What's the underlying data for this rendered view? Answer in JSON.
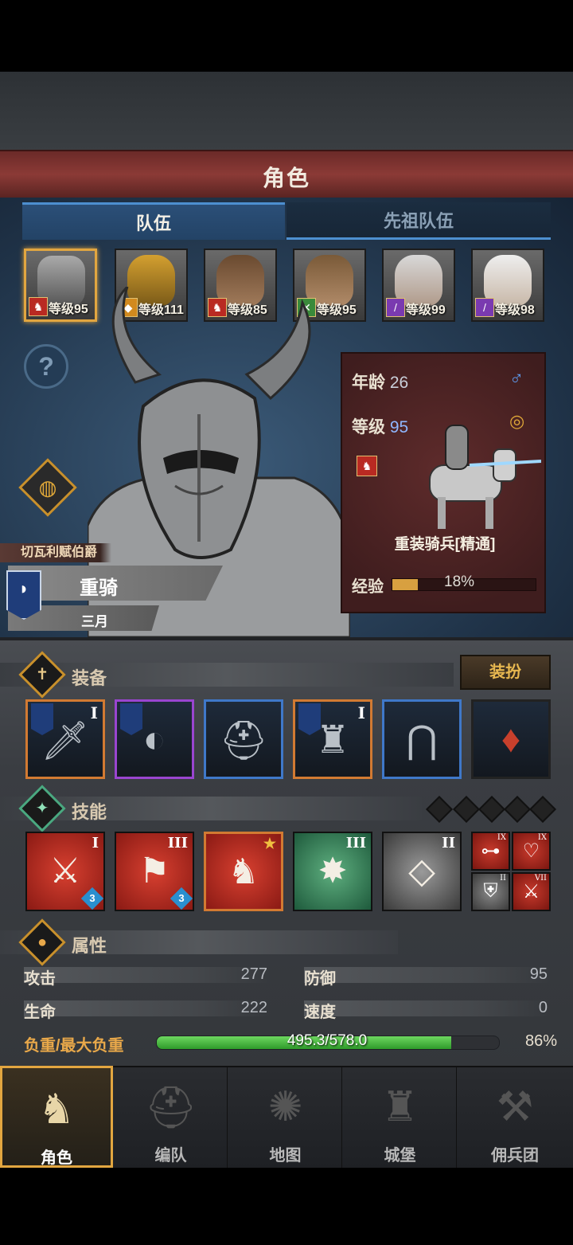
{
  "header": {
    "title": "角色"
  },
  "tabs": [
    {
      "label": "队伍",
      "active": true
    },
    {
      "label": "先祖队伍",
      "active": false
    }
  ],
  "team": [
    {
      "level": "等级95",
      "class_icon": "horse-icon",
      "class_color": "#b92a22",
      "selected": true
    },
    {
      "level": "等级111",
      "class_icon": "shield-icon",
      "class_color": "#d28a1e",
      "selected": false
    },
    {
      "level": "等级85",
      "class_icon": "horse-icon",
      "class_color": "#b92a22",
      "selected": false
    },
    {
      "level": "等级95",
      "class_icon": "bow-icon",
      "class_color": "#3a8a3a",
      "selected": false
    },
    {
      "level": "等级99",
      "class_icon": "staff-icon",
      "class_color": "#7a3ab0",
      "selected": false
    },
    {
      "level": "等级98",
      "class_icon": "staff-icon",
      "class_color": "#7a3ab0",
      "selected": false
    }
  ],
  "hero": {
    "title": "切瓦利赋伯爵",
    "name": "重骑",
    "month": "三月"
  },
  "info": {
    "age_label": "年龄",
    "age": "26",
    "level_label": "等级",
    "level": "95",
    "class_name": "重装骑兵[精通]",
    "exp_label": "经验",
    "exp_text": "18%",
    "exp_fraction": 0.18
  },
  "equipment": {
    "title": "装备",
    "dress_button": "装扮",
    "items": [
      {
        "icon": "sword-icon",
        "rank": "I",
        "rarity": "orange",
        "banner": true
      },
      {
        "icon": "shield-icon",
        "rank": "",
        "rarity": "purple",
        "banner": true
      },
      {
        "icon": "helmet-icon",
        "rank": "",
        "rarity": "blue",
        "banner": false
      },
      {
        "icon": "armor-icon",
        "rank": "I",
        "rarity": "orange",
        "banner": true
      },
      {
        "icon": "greaves-icon",
        "rank": "",
        "rarity": "blue",
        "banner": false
      },
      {
        "icon": "amulet-icon",
        "rank": "",
        "rarity": "none",
        "banner": false
      }
    ]
  },
  "skills": {
    "title": "技能",
    "items": [
      {
        "icon": "sword-skill-icon",
        "rank": "I",
        "color": "red",
        "level": "3",
        "selected": false
      },
      {
        "icon": "banner-skill-icon",
        "rank": "III",
        "color": "red",
        "level": "3",
        "selected": false
      },
      {
        "icon": "charge-skill-icon",
        "rank": "",
        "color": "red",
        "level": "",
        "selected": true
      },
      {
        "icon": "crystal-burst-icon",
        "rank": "III",
        "color": "green",
        "level": "",
        "selected": false
      },
      {
        "icon": "crystal-hand-icon",
        "rank": "II",
        "color": "grey",
        "level": "",
        "selected": false
      }
    ],
    "passives": [
      {
        "icon": "dumbbell-icon",
        "rank": "IX"
      },
      {
        "icon": "heart-icon",
        "rank": "IX"
      },
      {
        "icon": "defense-icon",
        "rank": "II"
      },
      {
        "icon": "dagger-icon",
        "rank": "VII"
      }
    ]
  },
  "attributes": {
    "title": "属性",
    "stats": [
      {
        "label": "攻击",
        "value": "277"
      },
      {
        "label": "防御",
        "value": "95"
      },
      {
        "label": "生命",
        "value": "222"
      },
      {
        "label": "速度",
        "value": "0"
      }
    ],
    "load_label": "负重/最大负重",
    "load_text": "495.3/578.0",
    "load_pct": "86%",
    "load_fraction": 0.86
  },
  "nav": [
    {
      "label": "角色",
      "icon": "knight-icon",
      "selected": true
    },
    {
      "label": "编队",
      "icon": "helmet-group-icon",
      "selected": false
    },
    {
      "label": "地图",
      "icon": "compass-icon",
      "selected": false
    },
    {
      "label": "城堡",
      "icon": "castle-icon",
      "selected": false
    },
    {
      "label": "佣兵团",
      "icon": "mercenary-icon",
      "selected": false
    }
  ],
  "colors": {
    "accent": "#e2a640",
    "tab_active": "#2b4f78",
    "title_bar": "#8b3a36"
  }
}
